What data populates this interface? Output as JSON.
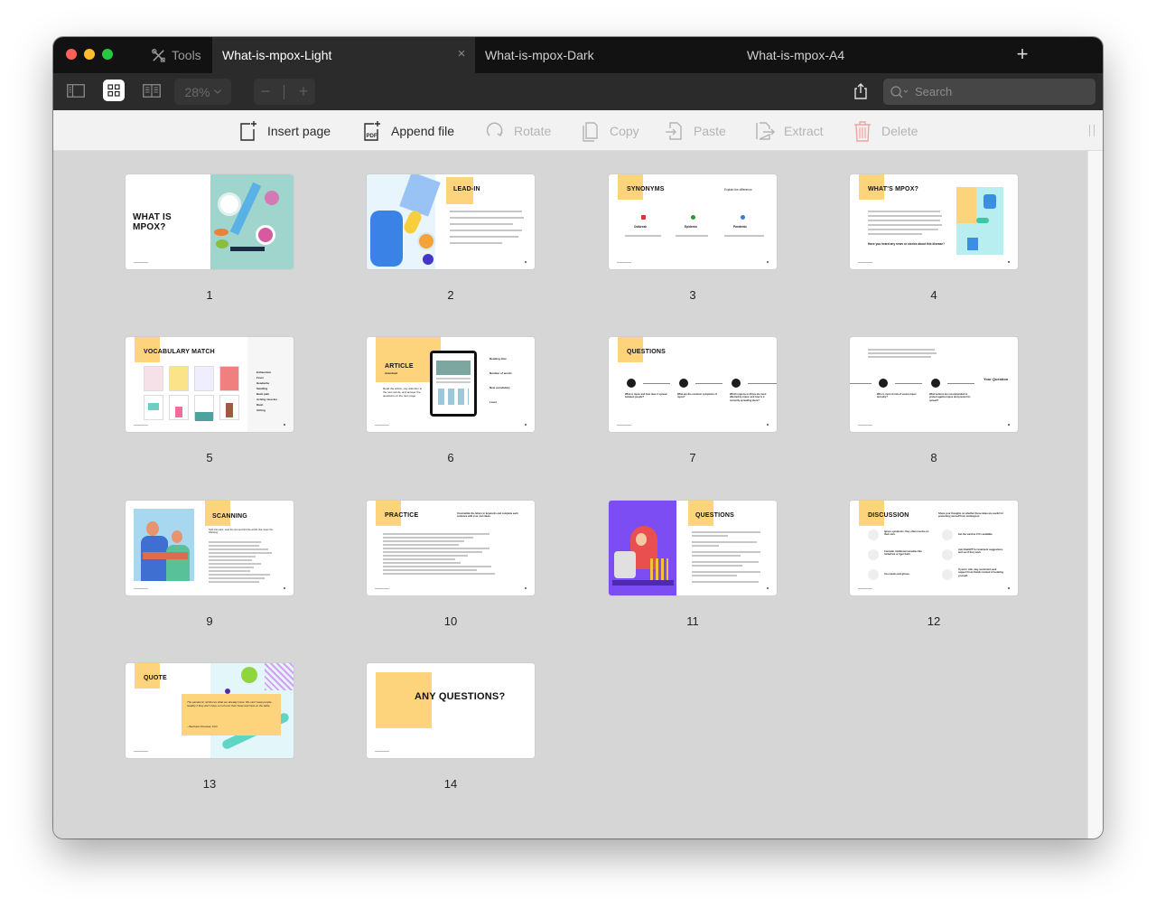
{
  "window": {
    "tools_label": "Tools",
    "tabs": [
      {
        "label": "What-is-mpox-Light",
        "active": true
      },
      {
        "label": "What-is-mpox-Dark",
        "active": false
      },
      {
        "label": "What-is-mpox-A4",
        "active": false
      }
    ],
    "close_glyph": "×",
    "add_tab_glyph": "+"
  },
  "toolbar": {
    "view_modes": [
      "sidebar-view",
      "grid-view",
      "two-page-view"
    ],
    "active_view": "grid-view",
    "zoom_level": "28%",
    "zoom_out_glyph": "−",
    "zoom_in_glyph": "+",
    "search_placeholder": "Search"
  },
  "actions": [
    {
      "label": "Insert page",
      "icon": "insert-page-icon",
      "enabled": true
    },
    {
      "label": "Append file",
      "icon": "append-pdf-icon",
      "enabled": true
    },
    {
      "label": "Rotate",
      "icon": "rotate-icon",
      "enabled": false
    },
    {
      "label": "Copy",
      "icon": "copy-icon",
      "enabled": false
    },
    {
      "label": "Paste",
      "icon": "paste-icon",
      "enabled": false
    },
    {
      "label": "Extract",
      "icon": "extract-icon",
      "enabled": false
    },
    {
      "label": "Delete",
      "icon": "trash-icon",
      "enabled": false
    }
  ],
  "colors": {
    "accent_yellow": "#fdd37c",
    "delete_red": "#f2a2a2",
    "purple_slide": "#7b4df2",
    "teal_slide": "#9fd5cc"
  },
  "pages": [
    {
      "number": "1",
      "title": "WHAT IS MPOX?"
    },
    {
      "number": "2",
      "title": "LEAD-IN"
    },
    {
      "number": "3",
      "title": "SYNONYMS",
      "subtitle": "Explain the difference",
      "terms": [
        "Outbreak",
        "Epidemic",
        "Pandemic"
      ]
    },
    {
      "number": "4",
      "title": "WHAT'S MPOX?",
      "question": "Have you heard any news or stories about this disease?"
    },
    {
      "number": "5",
      "title": "VOCABULARY MATCH",
      "words": [
        "Exhaustion",
        "Fever",
        "Headache",
        "Swelling",
        "Back pain",
        "Aching muscles",
        "Rash",
        "Itching"
      ]
    },
    {
      "number": "6",
      "title": "ARTICLE",
      "subtitle": "download",
      "body": "Read the article, pay attention to the new words, and answer the questions on the next page.",
      "info": [
        "Reading time",
        "Number of words",
        "New vocabulary",
        "Level"
      ]
    },
    {
      "number": "7",
      "title": "QUESTIONS",
      "questions": [
        "What is mpox and how does it spread between people?",
        "What are the common symptoms of mpox?",
        "Which regions in Africa are most affected by mpox, and how is it currently spreading there?"
      ]
    },
    {
      "number": "8",
      "questions": [
        "Who is most at risk of severe mpox and why?",
        "What actions are recommended to protect against mpox and prevent its spread?"
      ],
      "your_question": "Your Question"
    },
    {
      "number": "9",
      "title": "SCANNING",
      "subtitle": "Split into pairs, scan the text and find the words that mean the following:"
    },
    {
      "number": "10",
      "title": "PRACTICE",
      "subtitle": "Unscramble the letters in keywords and complete each sentence with your own ideas."
    },
    {
      "number": "11",
      "title": "QUESTIONS"
    },
    {
      "number": "12",
      "title": "DISCUSSION",
      "subtitle": "Share your thoughts on whether these ideas are useful for protecting yourself from monkeypox:",
      "ideas": [
        "Ignore symptoms; they often resolve on their own.",
        "Get the vaccine if it's available.",
        "Consider traditional remedies like herbal tea or tiger balm.",
        "Ask ChatGPT for treatment suggestions and see if they work.",
        "Use masks and gloves.",
        "If you're sick, stay social and seek support from friends instead of isolating yourself."
      ]
    },
    {
      "number": "13",
      "title": "QUOTE",
      "quote": "The pandemic reinforces what we already know. We can't keep people healthy if they don't have a roof over their head and food on the table.",
      "author": "– Bechara Choucair, M.D."
    },
    {
      "number": "14",
      "title": "ANY QUESTIONS?"
    }
  ]
}
